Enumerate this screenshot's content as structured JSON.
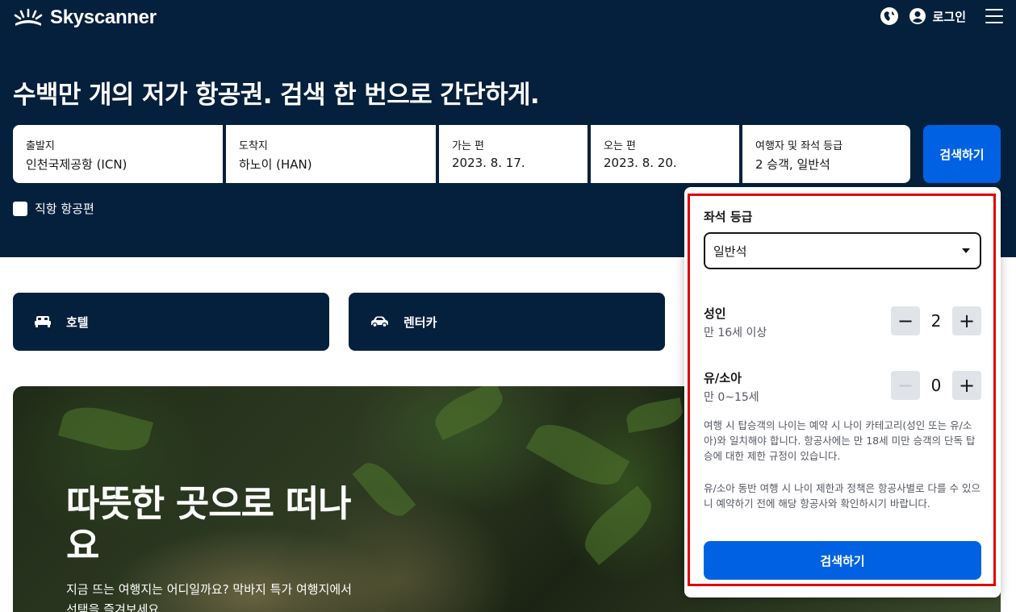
{
  "brand": {
    "name": "Skyscanner"
  },
  "header": {
    "login_label": "로그인"
  },
  "headline": "수백만 개의 저가 항공권. 검색 한 번으로 간단하게.",
  "search": {
    "origin": {
      "label": "출발지",
      "value": "인천국제공항 (ICN)"
    },
    "destination": {
      "label": "도착지",
      "value": "하노이 (HAN)"
    },
    "depart": {
      "label": "가는 편",
      "value": "2023. 8. 17."
    },
    "return": {
      "label": "오는 편",
      "value": "2023. 8. 20."
    },
    "travellers": {
      "label": "여행자 및 좌석 등급",
      "value": "2 승객, 일반석"
    },
    "button_label": "검색하기",
    "direct_label": "직항 항공편"
  },
  "tiles": {
    "hotel": "호텔",
    "car": "렌터카"
  },
  "promo": {
    "title": "따뜻한 곳으로 떠나요",
    "subtitle": "지금 뜨는 여행지는 어디일까요? 막바지 특가 여행지에서 선택을 즐겨보세요."
  },
  "popover": {
    "cabin_title": "좌석 등급",
    "cabin_value": "일반석",
    "adults": {
      "title": "성인",
      "sub": "만 16세 이상",
      "count": "2"
    },
    "children": {
      "title": "유/소아",
      "sub": "만 0~15세",
      "count": "0"
    },
    "note1": "여행 시 탑승객의 나이는 예약 시 나이 카테고리(성인 또는 유/소아)와 일치해야 합니다. 항공사에는 만 18세 미만 승객의 단독 탑승에 대한 제한 규정이 있습니다.",
    "note2": "유/소아 동반 여행 시 나이 제한과 정책은 항공사별로 다를 수 있으니 예약하기 전에 해당 항공사와 확인하시기 바랍니다.",
    "button_label": "검색하기"
  },
  "colors": {
    "navy": "#05203c",
    "blue": "#0062e3",
    "highlight": "#e00000"
  }
}
